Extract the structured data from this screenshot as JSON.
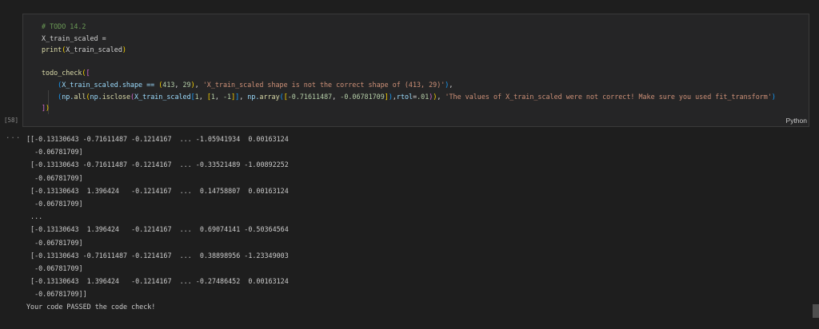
{
  "cell": {
    "execution_count": "[58]",
    "language": "Python",
    "code_lines": [
      {
        "tokens": [
          {
            "t": "# TODO 14.2",
            "c": "comment"
          }
        ]
      },
      {
        "tokens": [
          {
            "t": "X_train_scaled = ",
            "c": "plain"
          }
        ]
      },
      {
        "tokens": [
          {
            "t": "print",
            "c": "func"
          },
          {
            "t": "(",
            "c": "bracket1"
          },
          {
            "t": "X_train_scaled",
            "c": "plain"
          },
          {
            "t": ")",
            "c": "bracket1"
          }
        ]
      },
      {
        "tokens": [
          {
            "t": "",
            "c": "plain"
          }
        ]
      },
      {
        "tokens": [
          {
            "t": "todo_check",
            "c": "func"
          },
          {
            "t": "(",
            "c": "bracket1"
          },
          {
            "t": "[",
            "c": "bracket2"
          }
        ]
      },
      {
        "tokens": [
          {
            "t": "    ",
            "c": "plain"
          },
          {
            "t": "(",
            "c": "bracket3"
          },
          {
            "t": "X_train_scaled.shape == ",
            "c": "var"
          },
          {
            "t": "(",
            "c": "bracket1"
          },
          {
            "t": "413",
            "c": "num"
          },
          {
            "t": ", ",
            "c": "plain"
          },
          {
            "t": "29",
            "c": "num"
          },
          {
            "t": ")",
            "c": "bracket1"
          },
          {
            "t": ", ",
            "c": "plain"
          },
          {
            "t": "'X_train_scaled shape is not the correct shape of (413, 29)'",
            "c": "str"
          },
          {
            "t": ")",
            "c": "bracket3"
          },
          {
            "t": ",",
            "c": "plain"
          }
        ]
      },
      {
        "tokens": [
          {
            "t": "    ",
            "c": "plain"
          },
          {
            "t": "(",
            "c": "bracket3"
          },
          {
            "t": "np.",
            "c": "var"
          },
          {
            "t": "all",
            "c": "func"
          },
          {
            "t": "(",
            "c": "bracket1"
          },
          {
            "t": "np.",
            "c": "var"
          },
          {
            "t": "isclose",
            "c": "func"
          },
          {
            "t": "(",
            "c": "bracket2"
          },
          {
            "t": "X_train_scaled",
            "c": "var"
          },
          {
            "t": "[",
            "c": "bracket3"
          },
          {
            "t": "1",
            "c": "num"
          },
          {
            "t": ", ",
            "c": "plain"
          },
          {
            "t": "[",
            "c": "bracket1"
          },
          {
            "t": "1",
            "c": "num"
          },
          {
            "t": ", ",
            "c": "plain"
          },
          {
            "t": "-1",
            "c": "num"
          },
          {
            "t": "]",
            "c": "bracket1"
          },
          {
            "t": "]",
            "c": "bracket3"
          },
          {
            "t": ", ",
            "c": "plain"
          },
          {
            "t": "np.",
            "c": "var"
          },
          {
            "t": "array",
            "c": "func"
          },
          {
            "t": "(",
            "c": "bracket3"
          },
          {
            "t": "[",
            "c": "bracket1"
          },
          {
            "t": "-0.71611487",
            "c": "num"
          },
          {
            "t": ", ",
            "c": "plain"
          },
          {
            "t": "-0.06781709",
            "c": "num"
          },
          {
            "t": "]",
            "c": "bracket1"
          },
          {
            "t": ")",
            "c": "bracket3"
          },
          {
            "t": ",",
            "c": "plain"
          },
          {
            "t": "rtol",
            "c": "var"
          },
          {
            "t": "=",
            "c": "plain"
          },
          {
            "t": ".01",
            "c": "num"
          },
          {
            "t": ")",
            "c": "bracket2"
          },
          {
            "t": ")",
            "c": "bracket1"
          },
          {
            "t": ", ",
            "c": "plain"
          },
          {
            "t": "'The values of X_train_scaled were not correct! Make sure you used fit_transform'",
            "c": "str"
          },
          {
            "t": ")",
            "c": "bracket3"
          }
        ]
      },
      {
        "tokens": [
          {
            "t": "]",
            "c": "bracket2"
          },
          {
            "t": ")",
            "c": "bracket1"
          }
        ]
      }
    ]
  },
  "output": {
    "more_actions_label": "...",
    "lines": [
      "[[-0.13130643 -0.71611487 -0.1214167  ... -1.05941934  0.00163124",
      "  -0.06781709]",
      " [-0.13130643 -0.71611487 -0.1214167  ... -0.33521489 -1.00892252",
      "  -0.06781709]",
      " [-0.13130643  1.396424   -0.1214167  ...  0.14758807  0.00163124",
      "  -0.06781709]",
      " ...",
      " [-0.13130643  1.396424   -0.1214167  ...  0.69074141 -0.50364564",
      "  -0.06781709]",
      " [-0.13130643 -0.71611487 -0.1214167  ...  0.38898956 -1.23349003",
      "  -0.06781709]",
      " [-0.13130643  1.396424   -0.1214167  ... -0.27486452  0.00163124",
      "  -0.06781709]]",
      "Your code PASSED the code check!"
    ]
  }
}
